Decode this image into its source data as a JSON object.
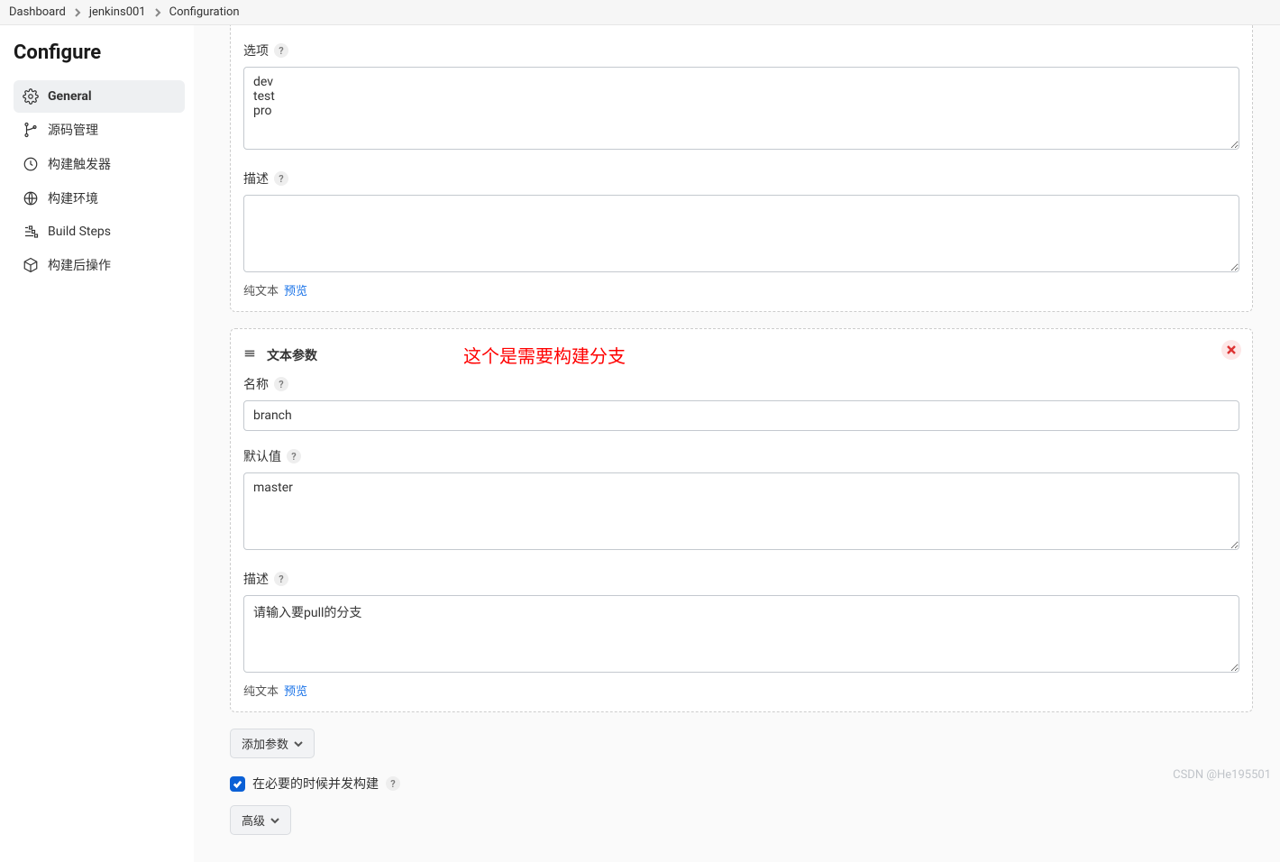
{
  "breadcrumbs": {
    "dashboard": "Dashboard",
    "job": "jenkins001",
    "page": "Configuration"
  },
  "page_title": "Configure",
  "sidebar": {
    "items": [
      {
        "label": "General"
      },
      {
        "label": "源码管理"
      },
      {
        "label": "构建触发器"
      },
      {
        "label": "构建环境"
      },
      {
        "label": "Build Steps"
      },
      {
        "label": "构建后操作"
      }
    ]
  },
  "labels": {
    "options": "选项",
    "description": "描述",
    "plain_text": "纯文本",
    "preview": "预览",
    "name": "名称",
    "default_value": "默认值",
    "add_param": "添加参数",
    "advanced": "高级"
  },
  "param1": {
    "options_value": "dev\ntest\npro",
    "description_value": ""
  },
  "param2": {
    "type_title": "文本参数",
    "annotation": "这个是需要构建分支",
    "name_value": "branch",
    "default_value": "master",
    "description_value": "请输入要pull的分支"
  },
  "concurrent": {
    "label": "在必要的时候并发构建"
  },
  "watermark": "CSDN @He195501"
}
